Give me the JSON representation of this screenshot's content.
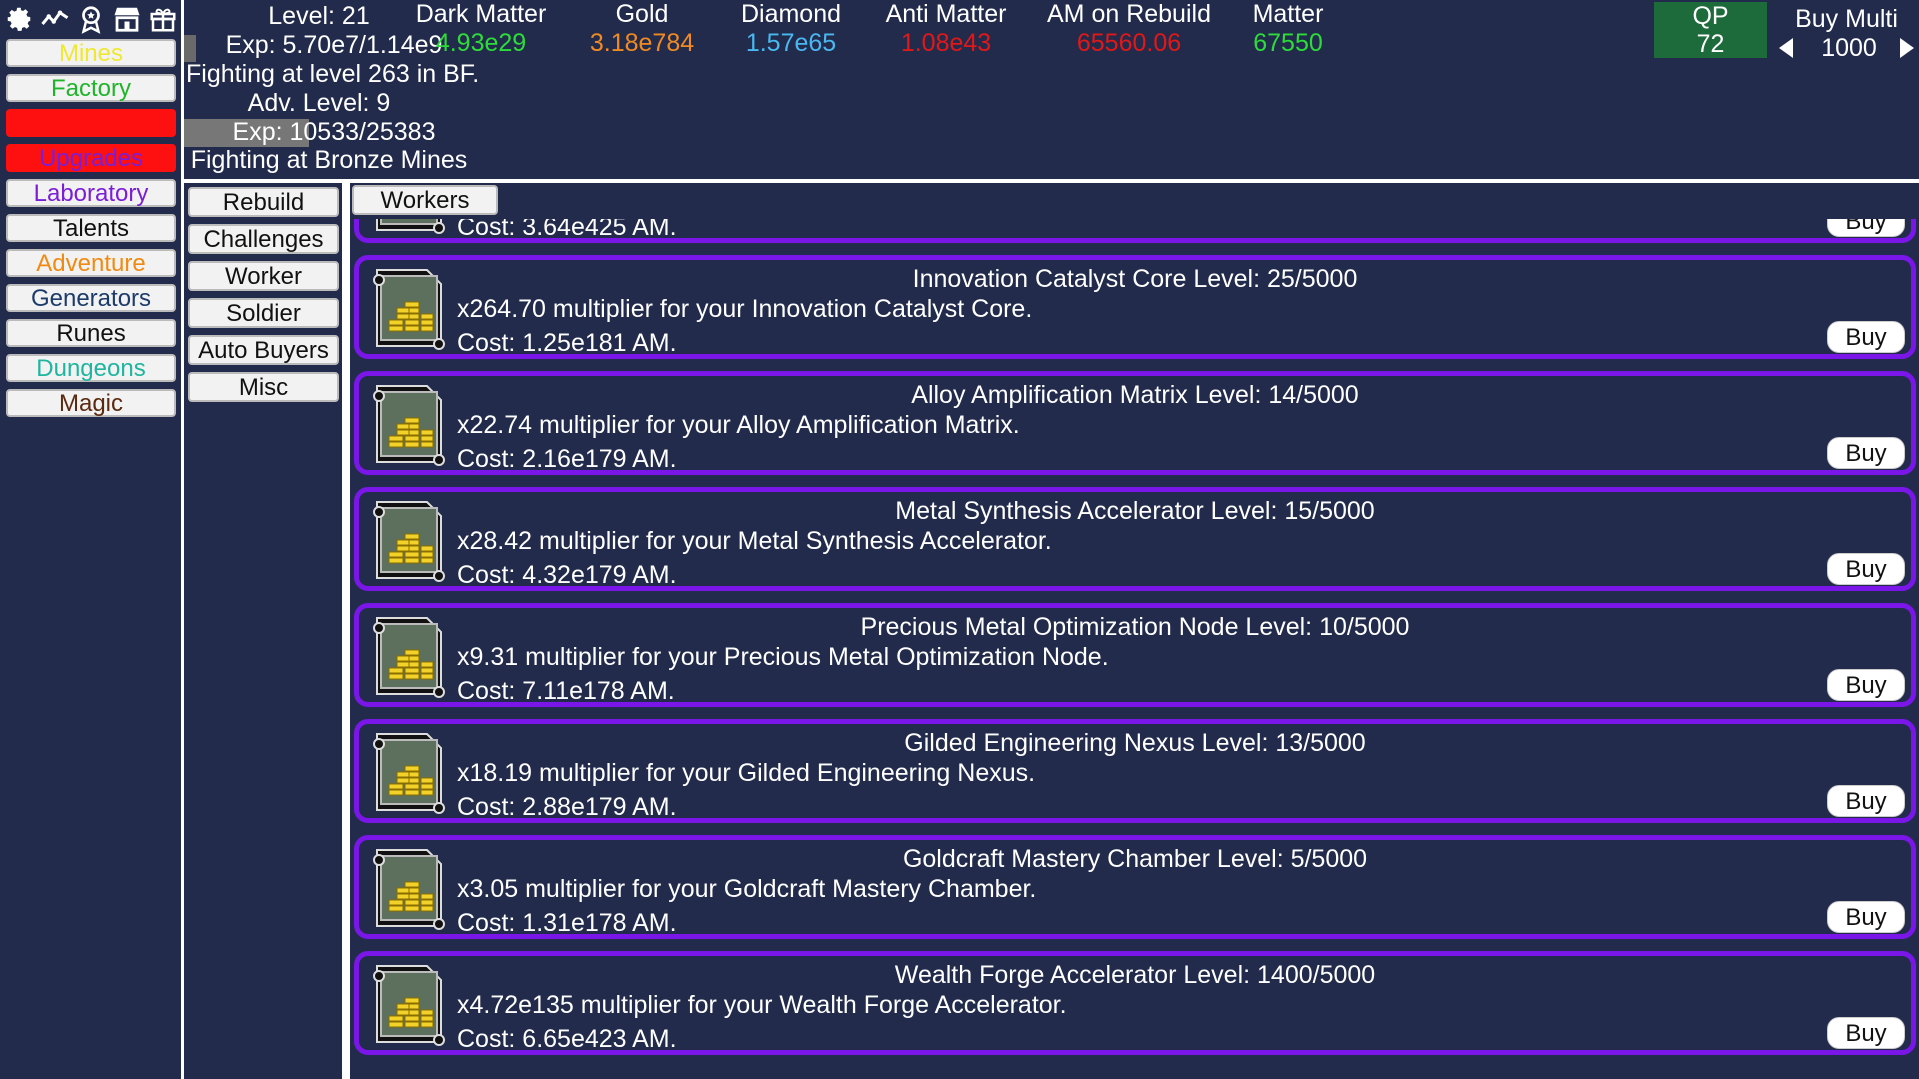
{
  "sidebar": {
    "items": [
      {
        "label": "Mines",
        "color": "#f0e830"
      },
      {
        "label": "Factory",
        "color": "#1fb52a"
      },
      {
        "label": "",
        "color": "#111111"
      },
      {
        "label": "Upgrades",
        "color": "#7a1ed8"
      },
      {
        "label": "Laboratory",
        "color": "#7a1ed8"
      },
      {
        "label": "Talents",
        "color": "#111111"
      },
      {
        "label": "Adventure",
        "color": "#f08a12"
      },
      {
        "label": "Generators",
        "color": "#1d3b6a"
      },
      {
        "label": "Runes",
        "color": "#111111"
      },
      {
        "label": "Dungeons",
        "color": "#1fb5a0"
      },
      {
        "label": "Magic",
        "color": "#5a2a10"
      }
    ],
    "active_color": "#ff1010"
  },
  "header": {
    "level": "Level: 21",
    "exp": "Exp: 5.70e7/1.14e9",
    "exp_progress": 0.05,
    "fighting": "Fighting at level 263 in BF.",
    "adv_level": "Adv. Level: 9",
    "adv_exp": "Exp: 10533/25383",
    "adv_exp_progress": 0.415,
    "adv_fighting": "Fighting at Bronze Mines",
    "stats": [
      {
        "label": "Dark Matter",
        "value": "4.93e29",
        "color": "#2ddc3a"
      },
      {
        "label": "Gold",
        "value": "3.18e784",
        "color": "#f08a22"
      },
      {
        "label": "Diamond",
        "value": "1.57e65",
        "color": "#4ab8f0"
      },
      {
        "label": "Anti Matter",
        "value": "1.08e43",
        "color": "#e01818"
      },
      {
        "label": "AM on Rebuild",
        "value": "65560.06",
        "color": "#e01818"
      },
      {
        "label": "Matter",
        "value": "67550",
        "color": "#2ddc3a"
      }
    ],
    "qp": {
      "label": "QP",
      "value": "72"
    },
    "buy_multi": {
      "label": "Buy Multi",
      "value": "1000"
    }
  },
  "submenu": [
    "Rebuild",
    "Challenges",
    "Worker",
    "Soldier",
    "Auto Buyers",
    "Misc"
  ],
  "tab": "Workers",
  "items": [
    {
      "title": "",
      "desc": "",
      "cost": "Cost: 3.64e425 AM.",
      "buy": "Buy"
    },
    {
      "title": "Innovation Catalyst Core Level: 25/5000",
      "desc": "x264.70 multiplier for your Innovation Catalyst Core.",
      "cost": "Cost: 1.25e181 AM.",
      "buy": "Buy"
    },
    {
      "title": "Alloy Amplification Matrix Level: 14/5000",
      "desc": "x22.74 multiplier for your Alloy Amplification Matrix.",
      "cost": "Cost: 2.16e179 AM.",
      "buy": "Buy"
    },
    {
      "title": "Metal Synthesis Accelerator Level: 15/5000",
      "desc": "x28.42 multiplier for your Metal Synthesis Accelerator.",
      "cost": "Cost: 4.32e179 AM.",
      "buy": "Buy"
    },
    {
      "title": "Precious Metal Optimization Node Level: 10/5000",
      "desc": "x9.31 multiplier for your Precious Metal Optimization Node.",
      "cost": "Cost: 7.11e178 AM.",
      "buy": "Buy"
    },
    {
      "title": "Gilded Engineering Nexus Level: 13/5000",
      "desc": "x18.19 multiplier for your Gilded Engineering Nexus.",
      "cost": "Cost: 2.88e179 AM.",
      "buy": "Buy"
    },
    {
      "title": "Goldcraft Mastery Chamber Level: 5/5000",
      "desc": "x3.05 multiplier for your Goldcraft Mastery Chamber.",
      "cost": "Cost: 1.31e178 AM.",
      "buy": "Buy"
    },
    {
      "title": "Wealth Forge Accelerator Level: 1400/5000",
      "desc": "x4.72e135 multiplier for your Wealth Forge Accelerator.",
      "cost": "Cost: 6.65e423 AM.",
      "buy": "Buy"
    }
  ],
  "icons": [
    "gear-icon",
    "chart-icon",
    "award-icon",
    "shop-icon",
    "gift-icon",
    "gold-coins-icon"
  ]
}
